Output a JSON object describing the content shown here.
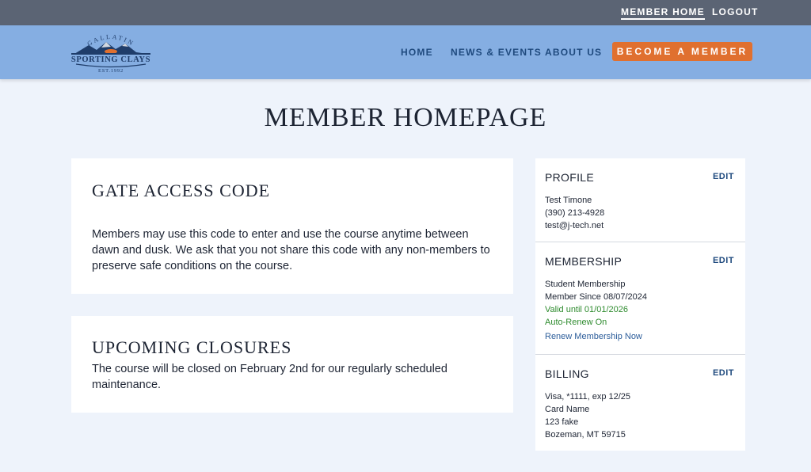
{
  "topbar": {
    "member_home": "MEMBER HOME",
    "logout": "LOGOUT"
  },
  "logo": {
    "arc_text": "GALLATIN",
    "name": "SPORTING CLAYS",
    "est": "EST.1992"
  },
  "nav": {
    "home": "HOME",
    "news_events": "NEWS & EVENTS",
    "about_us": "ABOUT US",
    "become_member": "BECOME A MEMBER"
  },
  "page_title": "MEMBER HOMEPAGE",
  "gate_access": {
    "title": "GATE ACCESS CODE",
    "description": "Members may use this code to enter and use the course anytime between dawn and dusk. We ask that you not share this code with any non-members to preserve safe conditions on the course."
  },
  "closures": {
    "title": "UPCOMING CLOSURES",
    "description": "The course will be closed on February 2nd for our regularly scheduled maintenance."
  },
  "profile": {
    "title": "PROFILE",
    "edit": "EDIT",
    "name": "Test Timone",
    "phone": "(390) 213-4928",
    "email": "test@j-tech.net"
  },
  "membership": {
    "title": "MEMBERSHIP",
    "edit": "EDIT",
    "type": "Student Membership",
    "since": "Member Since 08/07/2024",
    "valid_until": "Valid until 01/01/2026",
    "auto_renew": "Auto-Renew On",
    "renew_link": "Renew Membership Now"
  },
  "billing": {
    "title": "BILLING",
    "edit": "EDIT",
    "card": "Visa, *1111, exp 12/25",
    "card_name": "Card Name",
    "address1": "123 fake",
    "address2": "Bozeman, MT 59715"
  },
  "colors": {
    "topbar": "#5b6474",
    "navbar": "#85aee2",
    "accent_orange": "#e0702f",
    "nav_text": "#1f4a7e",
    "status_green": "#2e8b2e",
    "page_bg": "#eef3fb"
  }
}
